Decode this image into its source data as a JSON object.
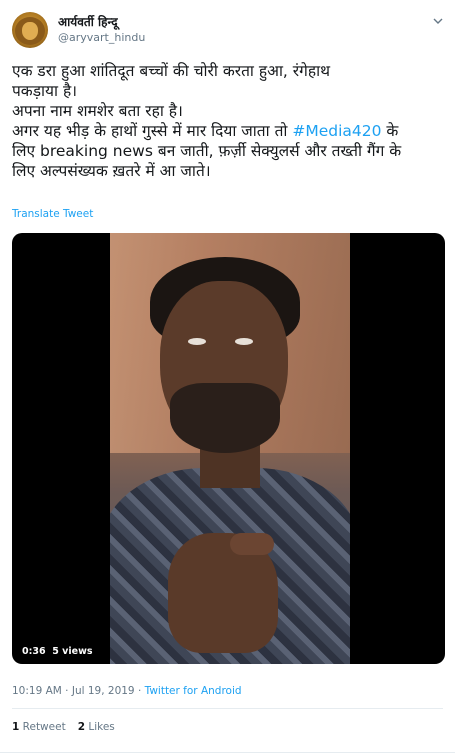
{
  "author": {
    "display_name": "आर्यवर्ती हिन्दू",
    "handle": "@aryvart_hindu"
  },
  "tweet": {
    "lines": [
      "एक डरा हुआ शांतिदूत बच्चों की चोरी करता हुआ, रंगेहाथ",
      "पकड़ाया है।",
      "अपना नाम शमशेर बता रहा है।",
      "अगर यह भीड़ के हाथों गुस्से में मार दिया जाता तो",
      "लिए breaking news बन जाती, फ़र्ज़ी सेक्युलर्स और तख्ती गैंग के",
      "लिए अल्पसंख्यक ख़तरे में आ जाते।"
    ],
    "hashtag": "#Media420",
    "hashtag_suffix": " के",
    "translate_label": "Translate Tweet"
  },
  "video": {
    "duration": "0:36",
    "views": "5 views"
  },
  "meta": {
    "timestamp": "10:19 AM · Jul 19, 2019 · ",
    "source": "Twitter for Android"
  },
  "stats": {
    "retweets_count": "1",
    "retweets_label": "Retweet",
    "likes_count": "2",
    "likes_label": "Likes"
  },
  "colors": {
    "accent": "#1da1f2",
    "text": "#14171a",
    "muted": "#657786"
  },
  "icons": {
    "caret": "chevron-down-icon"
  }
}
